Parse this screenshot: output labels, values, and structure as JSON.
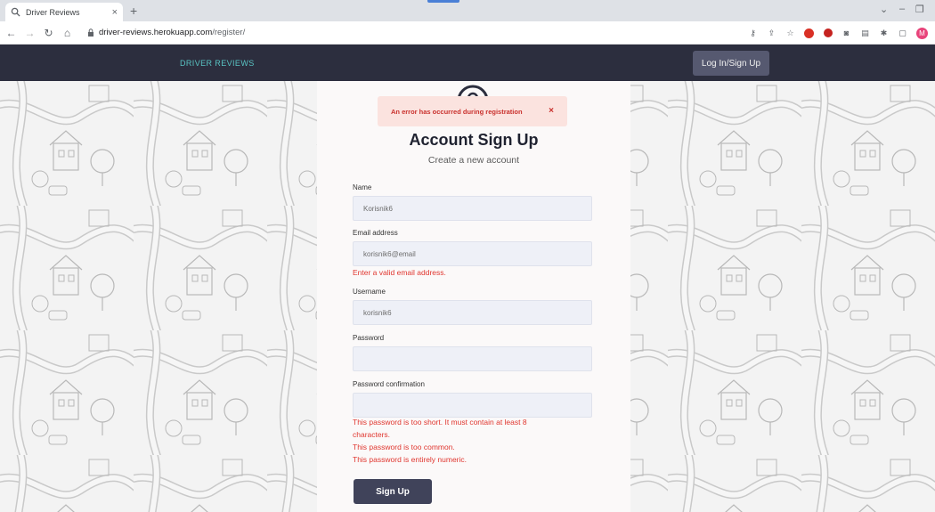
{
  "browser": {
    "tab_title": "Driver Reviews",
    "tab_close": "×",
    "new_tab": "+",
    "url_host": "driver-reviews.herokuapp.com",
    "url_path": "/register/",
    "avatar_letter": "M"
  },
  "site": {
    "brand": "DRIVER REVIEWS",
    "login_button": "Log In/Sign Up"
  },
  "form": {
    "alert": "An error has occurred during registration",
    "alert_close": "×",
    "title": "Account Sign Up",
    "subtitle": "Create a new account",
    "name_label": "Name",
    "name_value": "Korisnik6",
    "email_label": "Email address",
    "email_value": "korisnik6@email",
    "email_error": "Enter a valid email address.",
    "username_label": "Username",
    "username_value": "korisnik6",
    "password_label": "Password",
    "password_value": "",
    "confirm_label": "Password confirmation",
    "confirm_value": "",
    "password_errors": [
      "This password is too short. It must contain at least 8",
      "characters.",
      "This password is too common.",
      "This password is entirely numeric."
    ],
    "submit": "Sign Up"
  },
  "colors": {
    "nav": "#2c2e3e",
    "brand": "#59c3c3",
    "error": "#e0362f",
    "button": "#40435a"
  }
}
